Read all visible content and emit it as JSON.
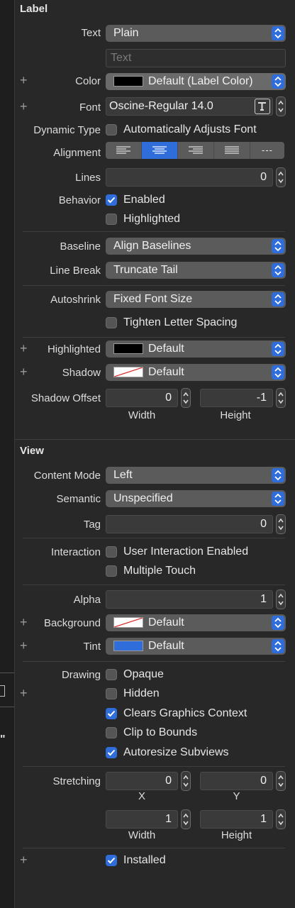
{
  "label_section": {
    "title": "Label",
    "text": {
      "label": "Text",
      "value": "Plain",
      "placeholder": "Text"
    },
    "color": {
      "label": "Color",
      "value": "Default (Label Color)",
      "swatch": "#000000"
    },
    "font": {
      "label": "Font",
      "value": "Oscine-Regular 14.0"
    },
    "dynamic_type": {
      "label": "Dynamic Type",
      "option": "Automatically Adjusts Font",
      "checked": false
    },
    "alignment": {
      "label": "Alignment",
      "selected": "center",
      "options": [
        "left",
        "center",
        "right",
        "justified",
        "natural"
      ],
      "natural_glyph": "---"
    },
    "lines": {
      "label": "Lines",
      "value": "0"
    },
    "behavior": {
      "label": "Behavior",
      "enabled": "Enabled",
      "enabled_checked": true,
      "highlighted": "Highlighted",
      "highlighted_checked": false
    },
    "baseline": {
      "label": "Baseline",
      "value": "Align Baselines"
    },
    "line_break": {
      "label": "Line Break",
      "value": "Truncate Tail"
    },
    "autoshrink": {
      "label": "Autoshrink",
      "value": "Fixed Font Size",
      "tighten": "Tighten Letter Spacing",
      "tighten_checked": false
    },
    "highlighted_color": {
      "label": "Highlighted",
      "value": "Default",
      "swatch": "#000000"
    },
    "shadow": {
      "label": "Shadow",
      "value": "Default"
    },
    "shadow_offset": {
      "label": "Shadow Offset",
      "width": "0",
      "height": "-1",
      "width_label": "Width",
      "height_label": "Height"
    }
  },
  "view_section": {
    "title": "View",
    "content_mode": {
      "label": "Content Mode",
      "value": "Left"
    },
    "semantic": {
      "label": "Semantic",
      "value": "Unspecified"
    },
    "tag": {
      "label": "Tag",
      "value": "0"
    },
    "interaction": {
      "label": "Interaction",
      "user_interaction": "User Interaction Enabled",
      "user_interaction_checked": false,
      "multiple_touch": "Multiple Touch",
      "multiple_touch_checked": false
    },
    "alpha": {
      "label": "Alpha",
      "value": "1"
    },
    "background": {
      "label": "Background",
      "value": "Default"
    },
    "tint": {
      "label": "Tint",
      "value": "Default",
      "swatch": "#2f6ddb"
    },
    "drawing": {
      "label": "Drawing",
      "opaque": "Opaque",
      "hidden": "Hidden",
      "clears": "Clears Graphics Context",
      "clip": "Clip to Bounds",
      "autoresize": "Autoresize Subviews",
      "opaque_checked": false,
      "hidden_checked": false,
      "clears_checked": true,
      "clip_checked": false,
      "autoresize_checked": true
    },
    "stretching": {
      "label": "Stretching",
      "x": "0",
      "y": "0",
      "width": "1",
      "height": "1",
      "x_label": "X",
      "y_label": "Y",
      "width_label": "Width",
      "height_label": "Height"
    },
    "installed": {
      "label": "Installed",
      "checked": true
    }
  },
  "colors": {
    "accent": "#2f6ddb",
    "background": "#282828",
    "popup": "#5b5b5b"
  }
}
